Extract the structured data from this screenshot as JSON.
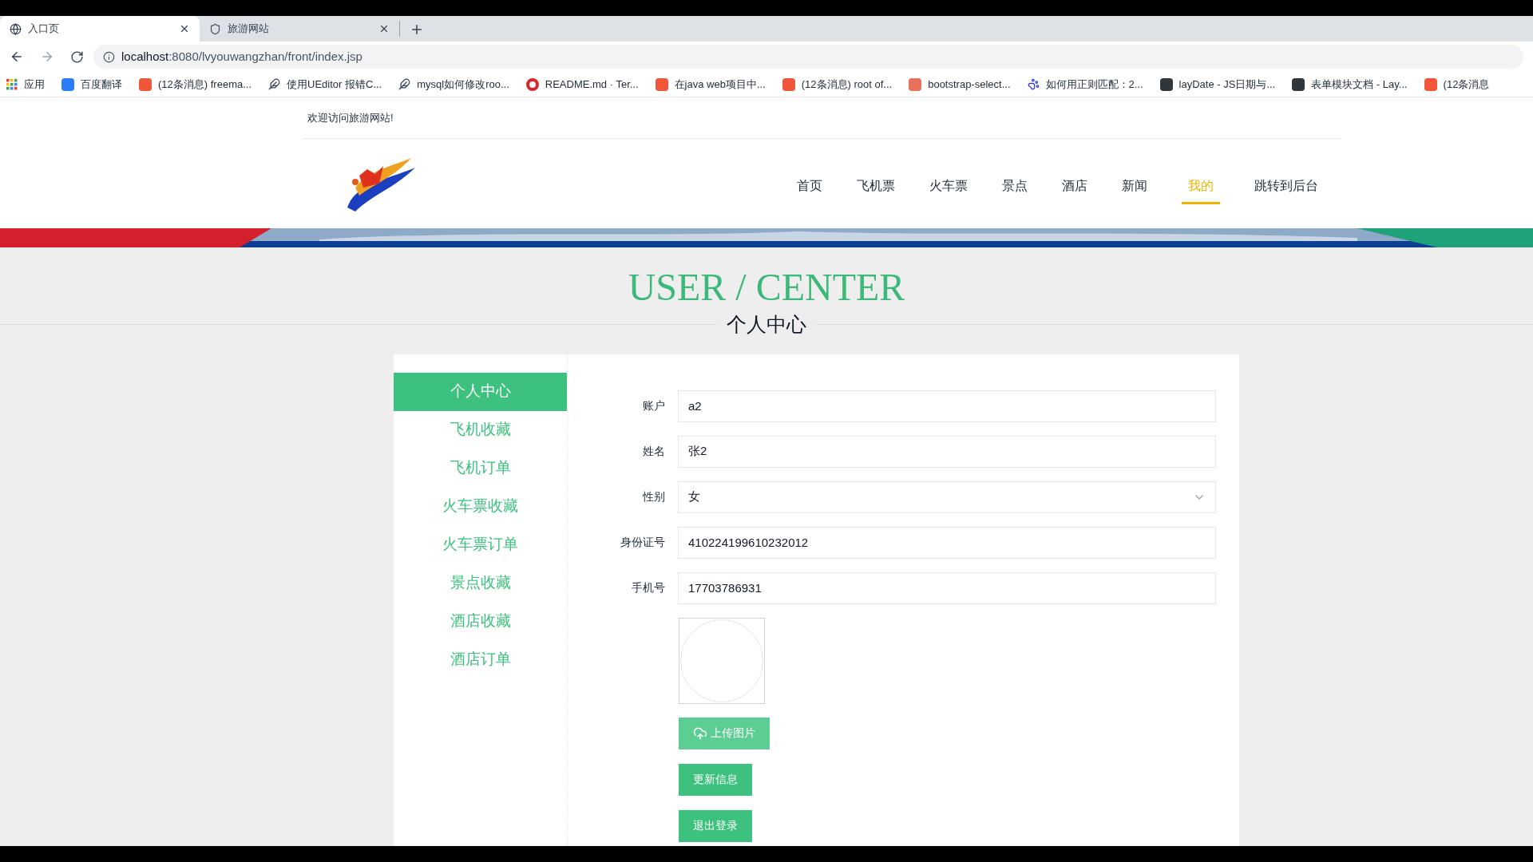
{
  "browser": {
    "tabs": [
      {
        "title": "入口页",
        "selected": true,
        "kind": "globe"
      },
      {
        "title": "旅游网站",
        "selected": false,
        "kind": "shield"
      }
    ],
    "url": {
      "host": "localhost",
      "rest": ":8080/lvyouwangzhan/front/index.jsp"
    },
    "bookmarks": [
      {
        "label": "应用",
        "kind": "apps"
      },
      {
        "label": "百度翻译",
        "kind": "translate"
      },
      {
        "label": "(12条消息) freema...",
        "kind": "c"
      },
      {
        "label": "使用UEditor 报错C...",
        "kind": "feather"
      },
      {
        "label": "mysql如何修改roo...",
        "kind": "feather"
      },
      {
        "label": "README.md · Ter...",
        "kind": "g"
      },
      {
        "label": "在java web项目中...",
        "kind": "c"
      },
      {
        "label": "(12条消息) root of...",
        "kind": "c"
      },
      {
        "label": "bootstrap-select...",
        "kind": "jian"
      },
      {
        "label": "如何用正则匹配：2...",
        "kind": "paw"
      },
      {
        "label": "layDate - JS日期与...",
        "kind": "lay"
      },
      {
        "label": "表单模块文档 - Lay...",
        "kind": "lay"
      },
      {
        "label": "(12条消息",
        "kind": "c"
      }
    ]
  },
  "site": {
    "welcome": "欢迎访问旅游网站!",
    "nav": [
      {
        "label": "首页",
        "selected": false
      },
      {
        "label": "飞机票",
        "selected": false
      },
      {
        "label": "火车票",
        "selected": false
      },
      {
        "label": "景点",
        "selected": false
      },
      {
        "label": "酒店",
        "selected": false
      },
      {
        "label": "新闻",
        "selected": false
      },
      {
        "label": "我的",
        "selected": true
      },
      {
        "label": "跳转到后台",
        "selected": false
      }
    ]
  },
  "heading": {
    "title": "USER / CENTER",
    "subtitle": "个人中心"
  },
  "sidebar": {
    "items": [
      {
        "label": "个人中心",
        "selected": true
      },
      {
        "label": "飞机收藏",
        "selected": false
      },
      {
        "label": "飞机订单",
        "selected": false
      },
      {
        "label": "火车票收藏",
        "selected": false
      },
      {
        "label": "火车票订单",
        "selected": false
      },
      {
        "label": "景点收藏",
        "selected": false
      },
      {
        "label": "酒店收藏",
        "selected": false
      },
      {
        "label": "酒店订单",
        "selected": false
      }
    ]
  },
  "form": {
    "fields": [
      {
        "label": "账户",
        "value": "a2",
        "kind": "text"
      },
      {
        "label": "姓名",
        "value": "张2",
        "kind": "text"
      },
      {
        "label": "性别",
        "value": "女",
        "kind": "select"
      },
      {
        "label": "身份证号",
        "value": "410224199610232012",
        "kind": "text"
      },
      {
        "label": "手机号",
        "value": "17703786931",
        "kind": "text"
      }
    ],
    "buttons": [
      {
        "label": "上传图片",
        "kind": "upload"
      },
      {
        "label": "更新信息",
        "kind": "plain"
      },
      {
        "label": "退出登录",
        "kind": "plain"
      }
    ]
  }
}
